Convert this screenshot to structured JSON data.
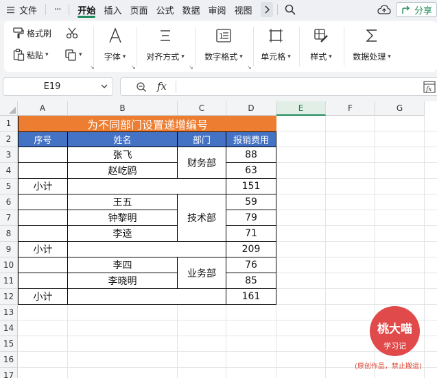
{
  "menu": {
    "file": "文件",
    "more": "···",
    "tabs": [
      "开始",
      "插入",
      "页面",
      "公式",
      "数据",
      "审阅",
      "视图"
    ],
    "share": "分享"
  },
  "ribbon": {
    "format_painter": "格式刷",
    "paste": "粘贴",
    "font": "字体",
    "align": "对齐方式",
    "number_format": "数字格式",
    "cell": "单元格",
    "style": "样式",
    "data_process": "数据处理"
  },
  "formula_bar": {
    "name_box": "E19",
    "fx": "fx",
    "value": ""
  },
  "columns": [
    "A",
    "B",
    "C",
    "D",
    "E",
    "F",
    "G"
  ],
  "rows": [
    "1",
    "2",
    "3",
    "4",
    "5",
    "6",
    "7",
    "8",
    "9",
    "10",
    "11",
    "12",
    "13",
    "14",
    "15",
    "16",
    "17"
  ],
  "table": {
    "title": "为不同部门设置递增编号",
    "headers": [
      "序号",
      "姓名",
      "部门",
      "报销费用"
    ],
    "names": [
      "张飞",
      "赵屹鸥",
      "王五",
      "钟黎明",
      "李逵",
      "李四",
      "李晓明"
    ],
    "depts": [
      "财务部",
      "技术部",
      "业务部"
    ],
    "amounts": [
      "88",
      "63",
      "151",
      "59",
      "79",
      "71",
      "209",
      "76",
      "85",
      "161"
    ],
    "subtotal_label": "小计"
  },
  "stamp": {
    "line1": "桃大喵",
    "line2": "学习记",
    "caption": "(原创作品，禁止搬运)"
  },
  "colors": {
    "accent": "#1f8a5a",
    "title_fill": "#ed7d31",
    "header_fill": "#4472c4",
    "stamp": "#e04a4a"
  }
}
